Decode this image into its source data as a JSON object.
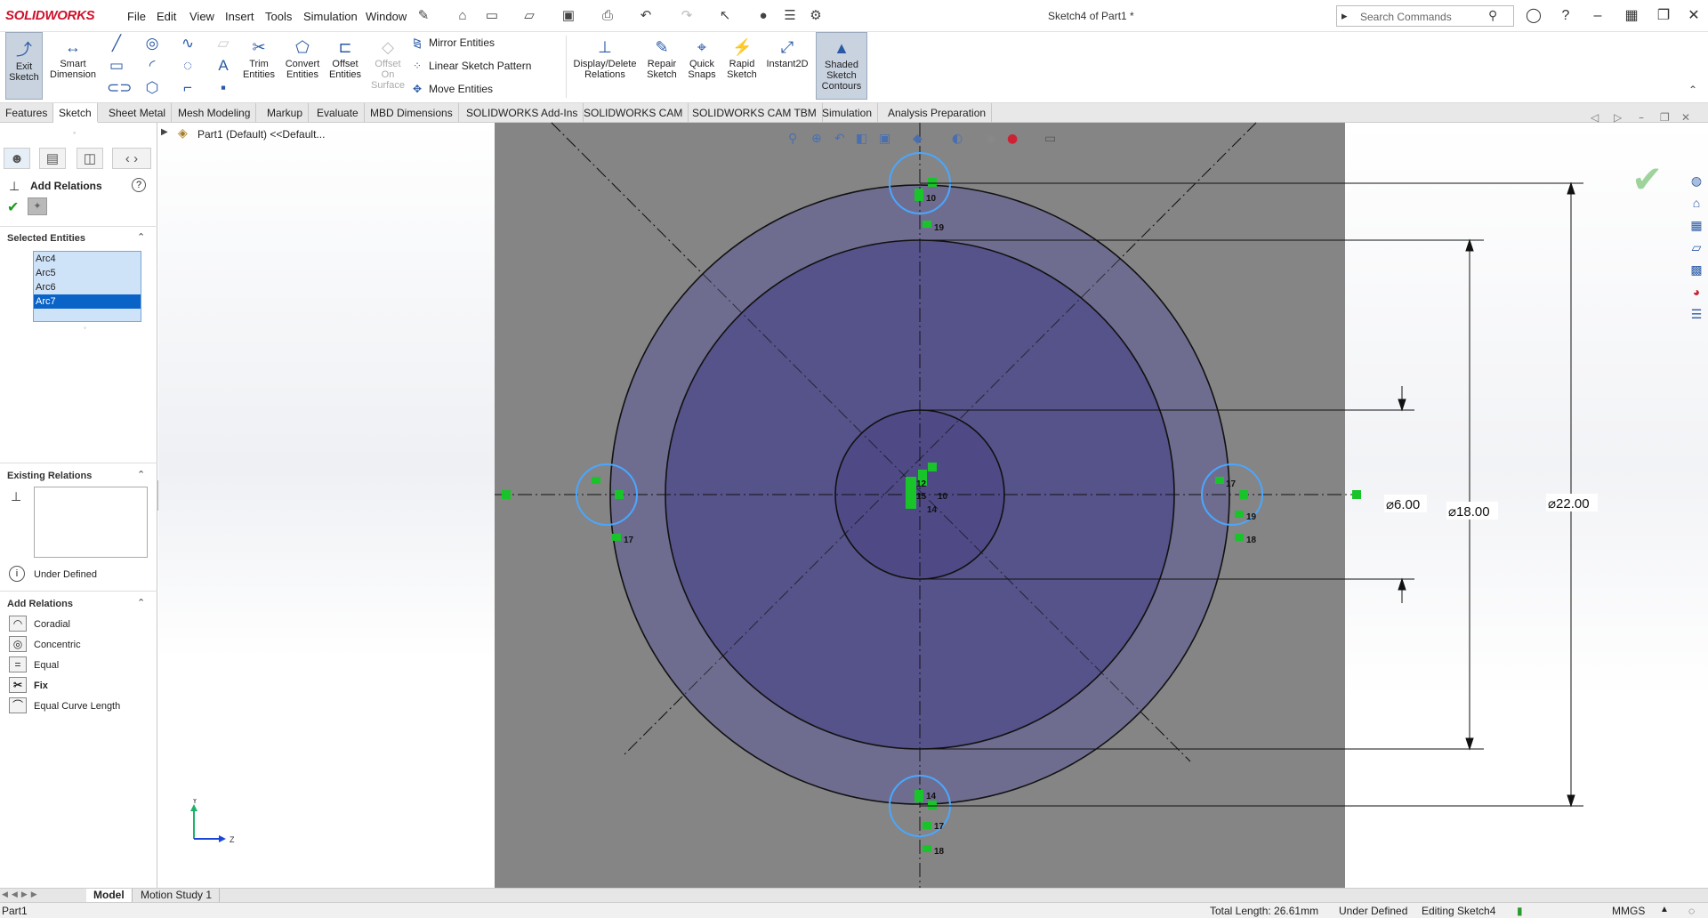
{
  "app": {
    "logo": "SOLIDWORKS",
    "doc_title": "Sketch4 of Part1 *",
    "menus": [
      "File",
      "Edit",
      "View",
      "Insert",
      "Tools",
      "Simulation",
      "Window"
    ],
    "search_placeholder": "Search Commands"
  },
  "ribbon": {
    "exit_sketch": "Exit Sketch",
    "smart_dimension": "Smart Dimension",
    "trim_entities": "Trim Entities",
    "convert_entities": "Convert Entities",
    "offset_entities": "Offset Entities",
    "offset_on_surface": "Offset On Surface",
    "mirror_entities": "Mirror Entities",
    "linear_sketch_pattern": "Linear Sketch Pattern",
    "move_entities": "Move Entities",
    "display_delete_relations": "Display/Delete Relations",
    "repair_sketch": "Repair Sketch",
    "quick_snaps": "Quick Snaps",
    "rapid_sketch": "Rapid Sketch",
    "instant2d": "Instant2D",
    "shaded_sketch_contours": "Shaded Sketch Contours"
  },
  "tabs": [
    "Features",
    "Sketch",
    "Sheet Metal",
    "Mesh Modeling",
    "Markup",
    "Evaluate",
    "MBD Dimensions",
    "SOLIDWORKS Add-Ins",
    "SOLIDWORKS CAM",
    "SOLIDWORKS CAM TBM",
    "Simulation",
    "Analysis Preparation"
  ],
  "active_tab": "Sketch",
  "panel": {
    "title": "Add Relations",
    "selected_entities_header": "Selected Entities",
    "selected_entities": [
      "Arc4",
      "Arc5",
      "Arc6",
      "Arc7"
    ],
    "selected_index": 3,
    "existing_relations_header": "Existing Relations",
    "status": "Under Defined",
    "add_relations_header": "Add Relations",
    "relations": [
      "Coradial",
      "Concentric",
      "Equal",
      "Fix",
      "Equal Curve Length"
    ]
  },
  "tree": {
    "root": "Part1 (Default) <<Default..."
  },
  "sketch": {
    "dimensions": [
      "⌀6.00",
      "⌀18.00",
      "⌀22.00"
    ],
    "relation_labels": [
      "10",
      "19",
      "17",
      "12",
      "15",
      "14",
      "10",
      "18",
      "19",
      "17",
      "14",
      "17",
      "18"
    ],
    "triad_y": "Y",
    "triad_z": "Z"
  },
  "bottom_tabs": [
    "Model",
    "Motion Study 1"
  ],
  "status": {
    "part": "Part1",
    "total_length": "Total Length: 26.61mm",
    "definition": "Under Defined",
    "editing": "Editing Sketch4",
    "units": "MMGS"
  },
  "colors": {
    "accent": "#2a5aa6",
    "brand": "#d0102a",
    "relation_green": "#18c42a",
    "selection_blue": "#0a64c8"
  }
}
